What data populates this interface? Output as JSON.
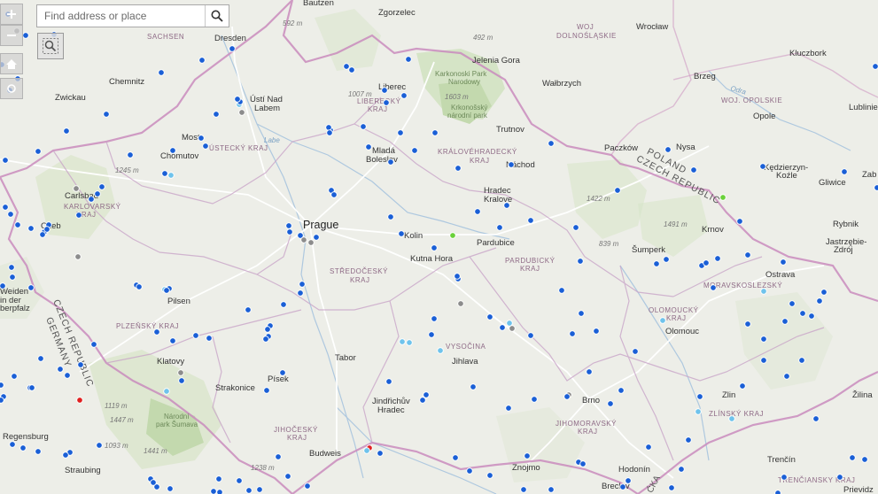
{
  "search": {
    "placeholder": "Find address or place"
  },
  "icons": {
    "search": "search-icon",
    "zoom_area": "zoom-area-icon",
    "zoom_in": "zoom-in-icon",
    "zoom_out": "zoom-out-icon",
    "home": "home-icon",
    "locate": "locate-icon"
  },
  "colors": {
    "point_normal": "#1a5fd6",
    "point_light": "#6fc3ec",
    "point_gray": "#8c8c8c",
    "point_red": "#e02020",
    "point_green": "#6ad13a",
    "border": "#c98bbd",
    "water": "#aec8df",
    "forest": "#cfe0bd"
  },
  "labels": {
    "countries": {
      "poland": "POLAND",
      "czech_republic_ne": "CZECH REPUBLIC",
      "czech_republic_w": "CZECH REPUBLIC",
      "germany": "GERMANY"
    },
    "regions": {
      "sachsen": "SACHSEN",
      "woj_dolnoslaskie_1": "WOJ",
      "woj_dolnoslaskie_2": "DOLNOŚLĄSKIE",
      "woj_opolskie": "WOJ. OPOLSKIE",
      "liberecky_1": "LIBERECKÝ",
      "liberecky_2": "KRAJ",
      "ustecky": "ÚSTECKÝ KRAJ",
      "kralovehradecky_1": "KRÁLOVÉHRADECKÝ",
      "kralovehradecky_2": "KRAJ",
      "karlovarsky_1": "KARLOVARSKÝ",
      "karlovarsky_2": "KRAJ",
      "stredocesky_1": "STŘEDOČESKÝ",
      "stredocesky_2": "KRAJ",
      "pardubicky_1": "PARDUBICKÝ",
      "pardubicky_2": "KRAJ",
      "olomoucky_1": "OLOMOUCKÝ",
      "olomoucky_2": "KRAJ",
      "moravskoslezsky": "MORAVSKOSLEZSKÝ",
      "plzensky": "PLZEŇSKÝ KRAJ",
      "vysocina": "VYSOČINA",
      "jihocesky_1": "JIHOČESKÝ",
      "jihocesky_2": "KRAJ",
      "jihomoravsky_1": "JIHOMORAVSKÝ",
      "jihomoravsky_2": "KRAJ",
      "zlinsky": "ZLÍNSKÝ KRAJ",
      "trenciansky": "TRENČIANSKY KRAJ"
    },
    "cities": {
      "bautzen": "Bautzen",
      "zgorzelec": "Zgorzelec",
      "wroclaw": "Wrocław",
      "dresden": "Dresden",
      "jelenia_gora": "Jelenia Gora",
      "kluczbork": "Kluczbork",
      "chemnitz": "Chemnitz",
      "brzeg": "Brzeg",
      "zwickau": "Zwickau",
      "usti_1": "Ústí Nad",
      "usti_2": "Labem",
      "liberec": "Liberec",
      "walbrzych": "Wałbrzych",
      "opole": "Opole",
      "lubliniec": "Lubliniec",
      "most": "Most",
      "trutnov": "Trutnov",
      "chomutov": "Chomutov",
      "mlada_1": "Mladá",
      "mlada_2": "Boleslav",
      "paczkow": "Paczków",
      "nysa": "Nysa",
      "nachod": "Náchod",
      "kedzierzyn_1": "Kędzierzyn-",
      "kedzierzyn_2": "Koźle",
      "gliwice": "Gliwice",
      "zab": "Zab",
      "carlsbad": "Carlsbad",
      "hradec_1": "Hradec",
      "hradec_2": "Kralove",
      "rybnik": "Rybnik",
      "cheb": "Cheb",
      "prague": "Prague",
      "kolin": "Kolin",
      "pardubice": "Pardubice",
      "krnov": "Krnov",
      "jastrzebie_1": "Jastrzębie-",
      "jastrzebie_2": "Zdrój",
      "sumperk": "Šumperk",
      "kutna_hora": "Kutna Hora",
      "ostrava": "Ostrava",
      "weiden_1": "Weiden",
      "weiden_2": "in der",
      "weiden_3": "berpfalz",
      "pilsen": "Pilsen",
      "olomouc": "Olomouc",
      "tabor": "Tabor",
      "klatovy": "Klatovy",
      "jihlava": "Jihlava",
      "strakonice": "Strakonice",
      "pisek": "Písek",
      "zlin": "Zlin",
      "zilina": "Žilina",
      "jindrichuv_1": "Jindřichův",
      "jindrichuv_2": "Hradec",
      "brno": "Brno",
      "regensburg": "Regensburg",
      "budweis": "Budweis",
      "trencin": "Trenčín",
      "znojmo": "Znojmo",
      "hodonin": "Hodonín",
      "straubing": "Straubing",
      "breclav": "Breclav",
      "prievidz": "Prievidz"
    },
    "natural": {
      "labe": "Labe",
      "odra": "Odra",
      "sumava_1": "Národní",
      "sumava_2": "park Šumava",
      "karkonoski_1": "Karkonoski Park",
      "karkonoski_2": "Narodowy",
      "krkonossky_1": "Krkonošský",
      "krkonossky_2": "národní park",
      "slaska": "ĆKA"
    },
    "elevations": {
      "e592": "592 m",
      "e492": "492 m",
      "e1007": "1007 m",
      "e1603": "1603 m",
      "e1245": "1245 m",
      "e1422": "1422 m",
      "e1491": "1491 m",
      "e839": "839 m",
      "e1119": "1119 m",
      "e1447": "1447 m",
      "e1093": "1093 m",
      "e1441": "1441 m",
      "e1238": "1238 m"
    }
  }
}
